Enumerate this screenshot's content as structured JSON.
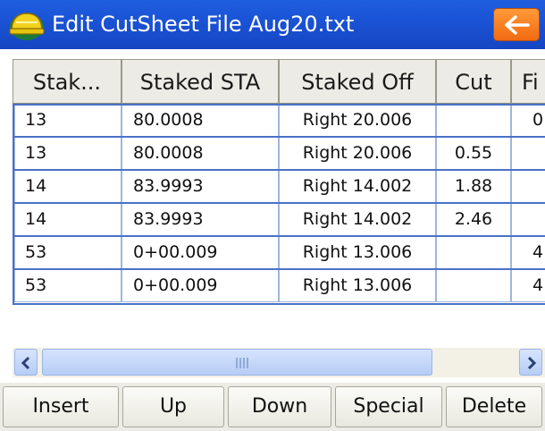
{
  "window": {
    "title": "Edit CutSheet File  Aug20.txt"
  },
  "header_icons": {
    "app": "hardhat-icon",
    "back": "back-arrow-icon"
  },
  "colors": {
    "titlebar": "#1a52d4",
    "back_button": "#f26a10",
    "row_border": "#4a72c7"
  },
  "table": {
    "columns": [
      "Stak...",
      "Staked STA",
      "Staked Off",
      "Cut",
      "Fi"
    ],
    "rows": [
      [
        "13",
        "80.0008",
        "Right 20.006",
        "",
        "0"
      ],
      [
        "13",
        "80.0008",
        "Right 20.006",
        "0.55",
        ""
      ],
      [
        "14",
        "83.9993",
        "Right 14.002",
        "1.88",
        ""
      ],
      [
        "14",
        "83.9993",
        "Right 14.002",
        "2.46",
        ""
      ],
      [
        "53",
        "0+00.009",
        "Right 13.006",
        "",
        "4"
      ],
      [
        "53",
        "0+00.009",
        "Right 13.006",
        "",
        "4"
      ]
    ]
  },
  "scrollbar": {
    "grip": "III"
  },
  "toolbar": {
    "insert": "Insert",
    "up": "Up",
    "down": "Down",
    "special": "Special",
    "delete": "Delete"
  }
}
